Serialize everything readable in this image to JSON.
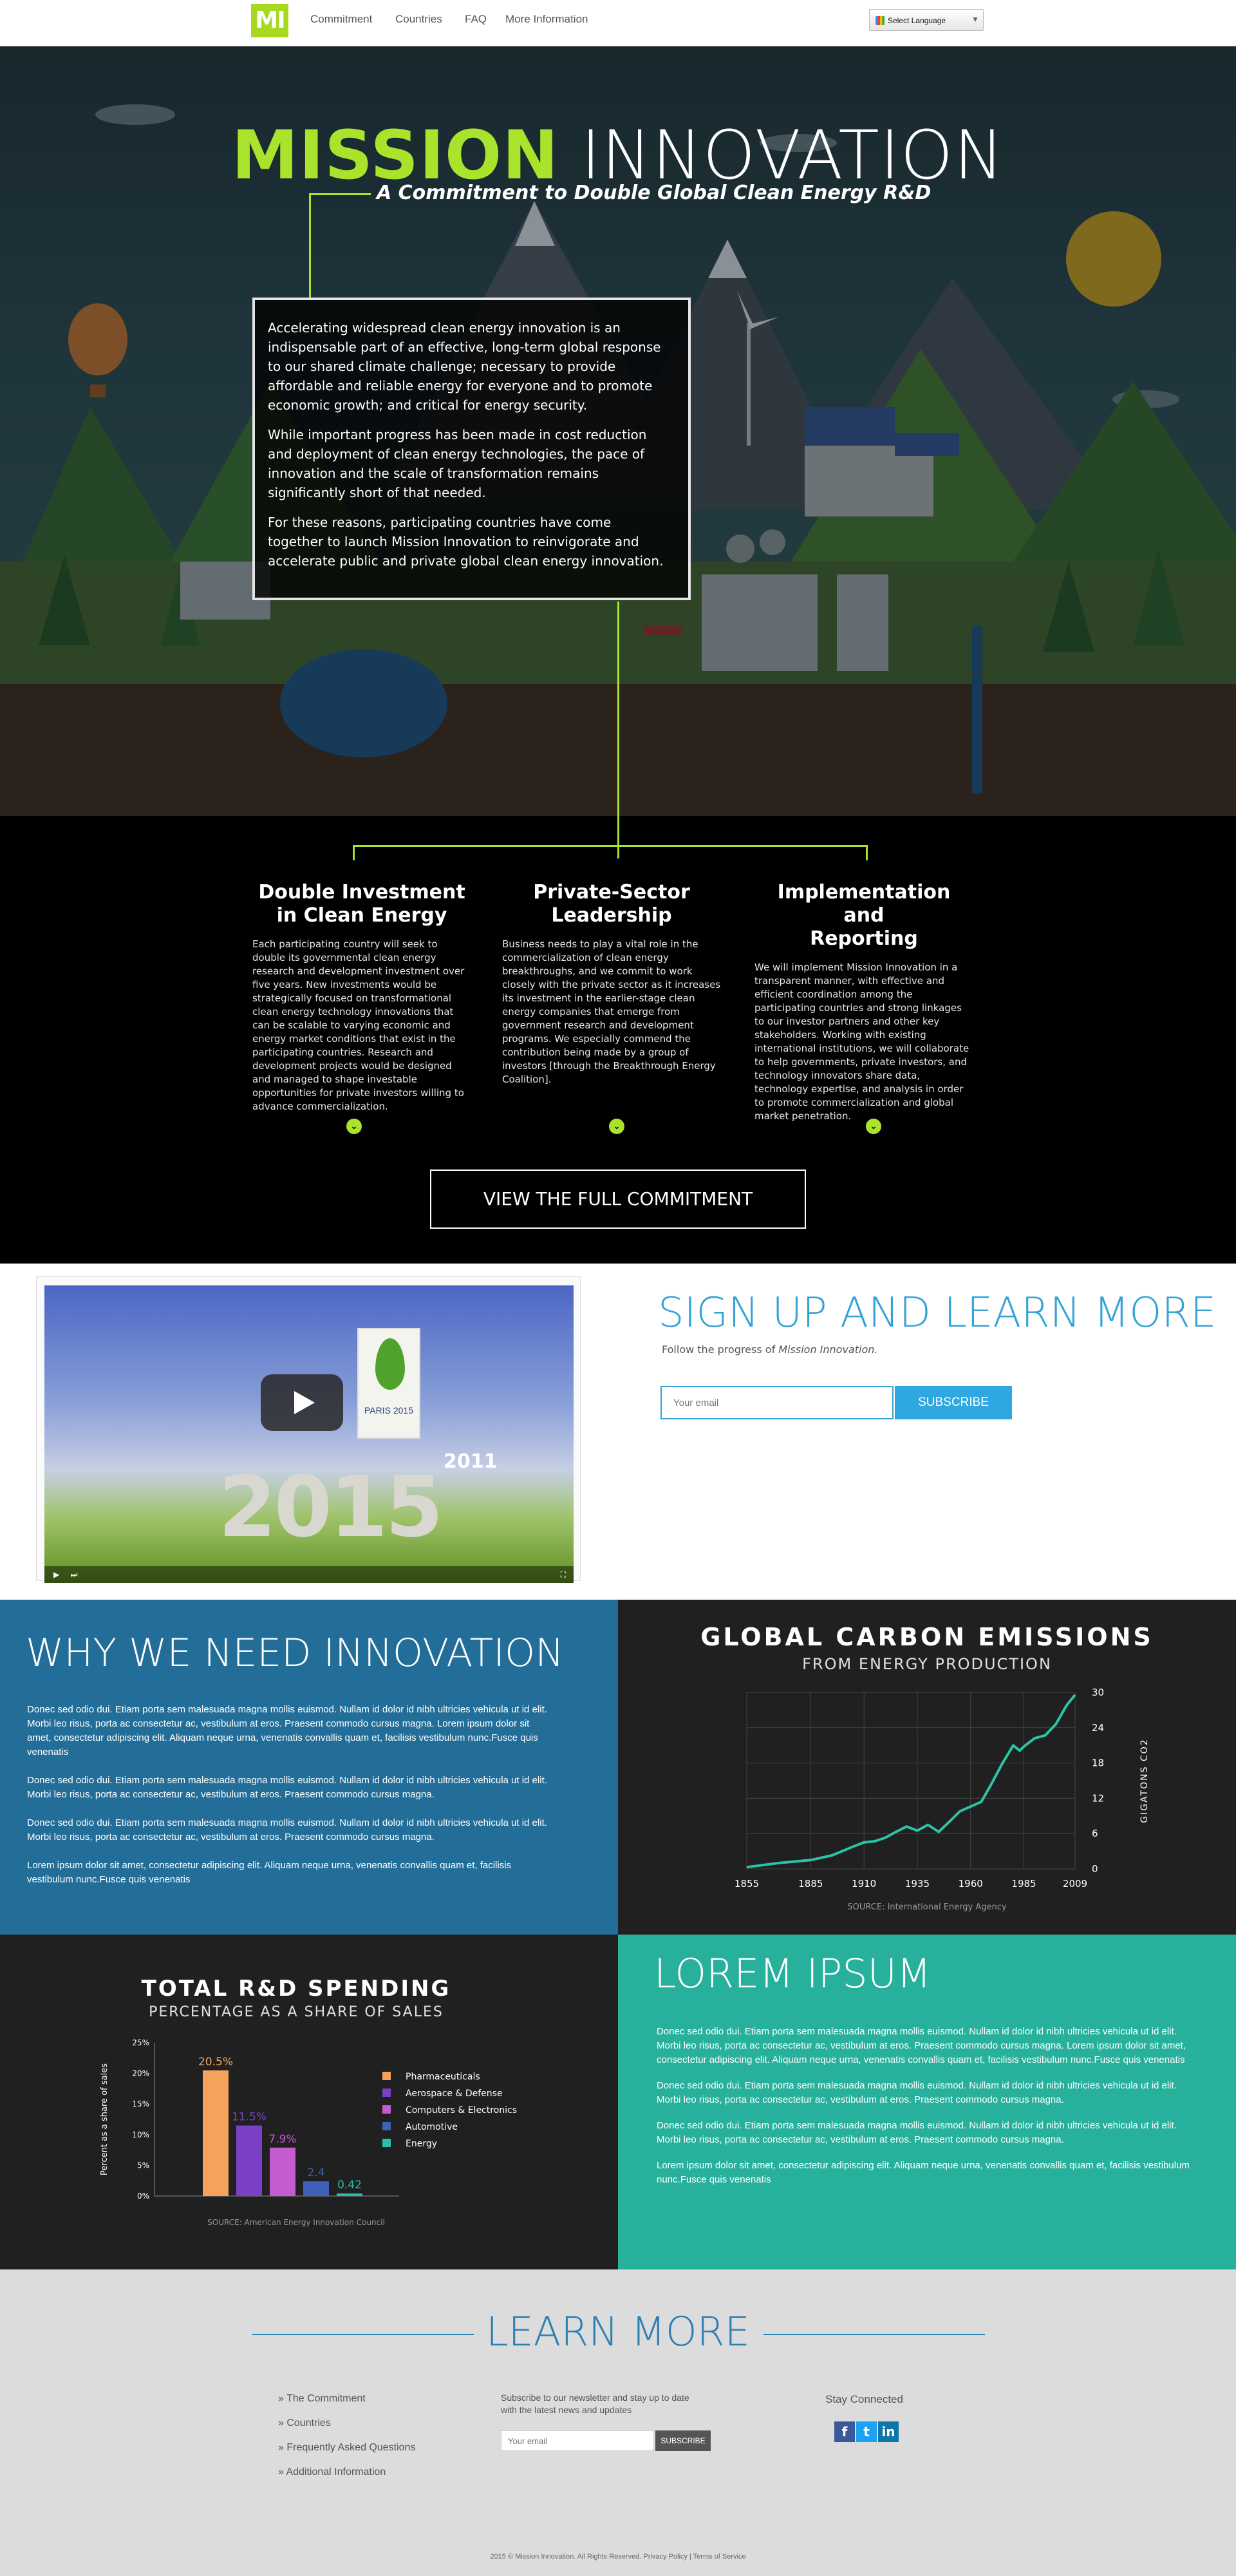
{
  "nav": {
    "logo": "MI",
    "links": [
      "Commitment",
      "Countries",
      "FAQ",
      "More Information"
    ],
    "language_select": "Select Language"
  },
  "hero": {
    "title_highlight": "MISSION",
    "title_rest": "INNOVATION",
    "subtitle": "A Commitment to Double Global Clean Energy R&D",
    "intro": [
      "Accelerating widespread clean energy innovation is an indispensable part of an effective, long-term global response to our shared climate challenge; necessary to provide affordable and reliable energy for everyone and to promote economic growth; and critical for energy security.",
      "While important progress has been made in cost reduction and deployment of clean energy technologies, the pace of innovation and the scale of transformation remains significantly short of that needed.",
      "For these reasons, participating countries have come together to launch Mission Innovation to reinvigorate and accelerate public and private global clean energy innovation."
    ]
  },
  "pillars": [
    {
      "title_line1": "Double Investment",
      "title_line2": "in Clean Energy",
      "text": "Each participating country will seek to double its governmental clean energy research and development investment over five years. New investments would be strategically focused on transformational clean energy technology innovations that can be scalable to varying economic and energy market conditions that exist in the participating countries. Research and development projects would be designed and managed to shape investable opportunities for private investors willing to advance commercialization."
    },
    {
      "title_line1": "Private-Sector",
      "title_line2": "Leadership",
      "text": "Business needs to play a vital role in the commercialization of clean energy breakthroughs, and we commit to work closely with the private sector as it increases its investment in the earlier-stage clean energy companies that emerge from government research and development programs. We especially commend the contribution being made by a group of investors [through the Breakthrough Energy Coalition]."
    },
    {
      "title_line1": "Implementation and",
      "title_line2": "Reporting",
      "text": "We will implement Mission Innovation in a transparent manner, with effective and efficient coordination among the participating countries and strong linkages to our investor partners and other key stakeholders. Working with existing international institutions, we will collaborate to help governments, private investors, and technology innovators share data, technology expertise, and analysis in order to promote commercialization and global market penetration."
    }
  ],
  "full_commitment_button": "VIEW THE FULL COMMITMENT",
  "video": {
    "sign_text": "PARIS 2015",
    "year_small": "2011",
    "year_big": "2015"
  },
  "signup": {
    "title": "SIGN UP AND LEARN MORE",
    "subtitle_prefix": "Follow the progress of ",
    "subtitle_em": "Mission Innovation.",
    "email_placeholder": "Your email",
    "subscribe_label": "SUBSCRIBE"
  },
  "why": {
    "title": "WHY WE NEED INNOVATION",
    "paragraphs": [
      "Donec sed odio dui. Etiam porta sem malesuada magna mollis euismod. Nullam id dolor id nibh ultricies vehicula ut id elit. Morbi leo risus, porta ac consectetur ac, vestibulum at eros. Praesent commodo cursus magna. Lorem ipsum dolor sit amet, consectetur adipiscing elit. Aliquam neque urna, venenatis convallis quam et, facilisis vestibulum nunc.Fusce quis venenatis",
      "Donec sed odio dui. Etiam porta sem malesuada magna mollis euismod. Nullam id dolor id nibh ultricies vehicula ut id elit. Morbi leo risus, porta ac consectetur ac, vestibulum at eros. Praesent commodo cursus magna.",
      "Donec sed odio dui. Etiam porta sem malesuada magna mollis euismod. Nullam id dolor id nibh ultricies vehicula ut id elit. Morbi leo risus, porta ac consectetur ac, vestibulum at eros. Praesent commodo cursus magna.",
      "Lorem ipsum dolor sit amet, consectetur adipiscing elit. Aliquam neque urna, venenatis convallis quam et, facilisis vestibulum nunc.Fusce quis venenatis"
    ]
  },
  "lorem": {
    "title": "LOREM IPSUM",
    "paragraphs": [
      "Donec sed odio dui. Etiam porta sem malesuada magna mollis euismod. Nullam id dolor id nibh ultricies vehicula ut id elit. Morbi leo risus, porta ac consectetur ac, vestibulum at eros. Praesent commodo cursus magna. Lorem ipsum dolor sit amet, consectetur adipiscing elit. Aliquam neque urna, venenatis convallis quam et, facilisis vestibulum nunc.Fusce quis venenatis",
      "Donec sed odio dui. Etiam porta sem malesuada magna mollis euismod. Nullam id dolor id nibh ultricies vehicula ut id elit. Morbi leo risus, porta ac consectetur ac, vestibulum at eros. Praesent commodo cursus magna.",
      "Donec sed odio dui. Etiam porta sem malesuada magna mollis euismod. Nullam id dolor id nibh ultricies vehicula ut id elit. Morbi leo risus, porta ac consectetur ac, vestibulum at eros. Praesent commodo cursus magna.",
      "Lorem ipsum dolor sit amet, consectetur adipiscing elit. Aliquam neque urna, venenatis convallis quam et, facilisis vestibulum nunc.Fusce quis venenatis"
    ]
  },
  "chart_data": [
    {
      "type": "line",
      "title": "GLOBAL CARBON EMISSIONS",
      "subtitle": "FROM ENERGY PRODUCTION",
      "ylabel": "GIGATONS CO2",
      "xlabel": "",
      "xticks": [
        1855,
        1885,
        1910,
        1935,
        1960,
        1985,
        2009
      ],
      "yticks": [
        0,
        6,
        12,
        18,
        24,
        30
      ],
      "xlim": [
        1855,
        2009
      ],
      "ylim": [
        0,
        30
      ],
      "source": "SOURCE: International Energy Agency",
      "color": "#2cc3a6",
      "grid": true,
      "x": [
        1855,
        1870,
        1885,
        1895,
        1905,
        1910,
        1915,
        1920,
        1925,
        1930,
        1935,
        1940,
        1945,
        1950,
        1955,
        1960,
        1965,
        1970,
        1975,
        1980,
        1983,
        1985,
        1990,
        1995,
        2000,
        2005,
        2009
      ],
      "y": [
        0.3,
        1.0,
        1.5,
        2.3,
        3.8,
        4.5,
        4.7,
        5.3,
        6.3,
        7.2,
        6.5,
        7.5,
        6.3,
        8.0,
        9.8,
        10.6,
        11.4,
        14.6,
        18.0,
        21.0,
        20.1,
        20.8,
        22.2,
        22.7,
        24.6,
        27.8,
        29.6
      ]
    },
    {
      "type": "bar",
      "title": "TOTAL R&D SPENDING",
      "subtitle": "PERCENTAGE AS A SHARE OF SALES",
      "ylabel": "Percent as a share of sales",
      "xlabel": "",
      "categories": [
        "Pharmaceuticals",
        "Aerospace & Defense",
        "Computers & Electronics",
        "Automotive",
        "Energy"
      ],
      "values": [
        20.5,
        11.5,
        7.9,
        2.4,
        0.42
      ],
      "value_labels": [
        "20.5%",
        "11.5%",
        "7.9%",
        "2.4",
        "0.42"
      ],
      "yticks": [
        "0%",
        "5%",
        "10%",
        "15%",
        "20%",
        "25%"
      ],
      "ylim": [
        0,
        25
      ],
      "colors": [
        "#f5a25d",
        "#7b3fc8",
        "#c55bd1",
        "#3f5fb8",
        "#2cbfa8"
      ],
      "legend": "right",
      "source": "SOURCE: American Energy Innovation Council"
    }
  ],
  "learn_more": {
    "title": "LEARN MORE",
    "links": [
      "» The Commitment",
      "» Countries",
      "» Frequently Asked Questions",
      "» Additional Information"
    ],
    "newsletter_text": "Subscribe to our newsletter and stay up to date with the latest news and updates",
    "email_placeholder": "Your email",
    "subscribe_label": "SUBSCRIBE",
    "stay_connected": "Stay Connected",
    "social": [
      {
        "name": "facebook-icon",
        "glyph": "f",
        "color": "#3b5998"
      },
      {
        "name": "twitter-icon",
        "glyph": "t",
        "color": "#1da1f2"
      },
      {
        "name": "linkedin-icon",
        "glyph": "in",
        "color": "#0e76a8"
      }
    ],
    "copyright": "2015 © Mission Innovation. All Rights Reserved. Privacy Policy | Terms of Service"
  }
}
